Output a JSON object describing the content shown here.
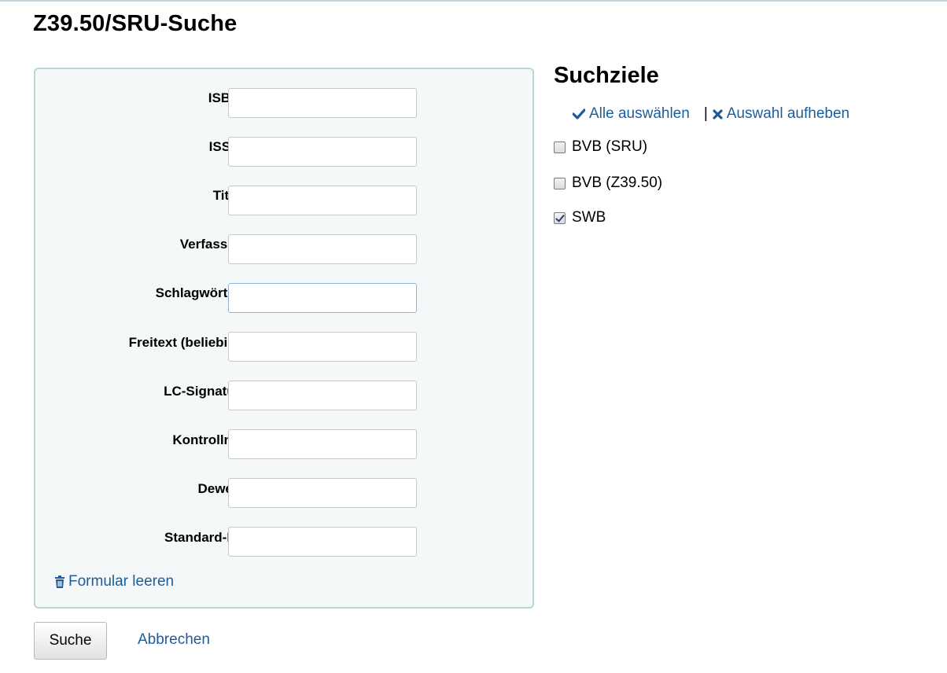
{
  "page": {
    "title": "Z39.50/SRU-Suche"
  },
  "form": {
    "fields": [
      {
        "label": "ISBN:",
        "value": ""
      },
      {
        "label": "ISSN:",
        "value": ""
      },
      {
        "label": "Titel:",
        "value": ""
      },
      {
        "label": "Verfasser:",
        "value": ""
      },
      {
        "label": "Schlagwörter:",
        "value": ""
      },
      {
        "label": "Freitext (beliebig):",
        "value": ""
      },
      {
        "label": "LC-Signatur:",
        "value": ""
      },
      {
        "label": "Kontrollnr.:",
        "value": ""
      },
      {
        "label": "Dewey:",
        "value": ""
      },
      {
        "label": "Standard-ID:",
        "value": ""
      }
    ],
    "clear_label": "Formular leeren",
    "clear_icon": "trash-icon",
    "submit_label": "Suche",
    "cancel_label": "Abbrechen"
  },
  "targets": {
    "title": "Suchziele",
    "select_all_label": "Alle auswählen",
    "select_all_icon": "checkmark-icon",
    "separator": "|",
    "clear_all_label": "Auswahl aufheben",
    "clear_all_icon": "x-icon",
    "items": [
      {
        "label": "BVB (SRU)",
        "checked": false
      },
      {
        "label": "BVB (Z39.50)",
        "checked": false
      },
      {
        "label": "SWB",
        "checked": true
      }
    ]
  },
  "colors": {
    "link": "#1e5b9b",
    "form_bg": "#f4f8f9",
    "form_border": "#b9d7d9"
  }
}
